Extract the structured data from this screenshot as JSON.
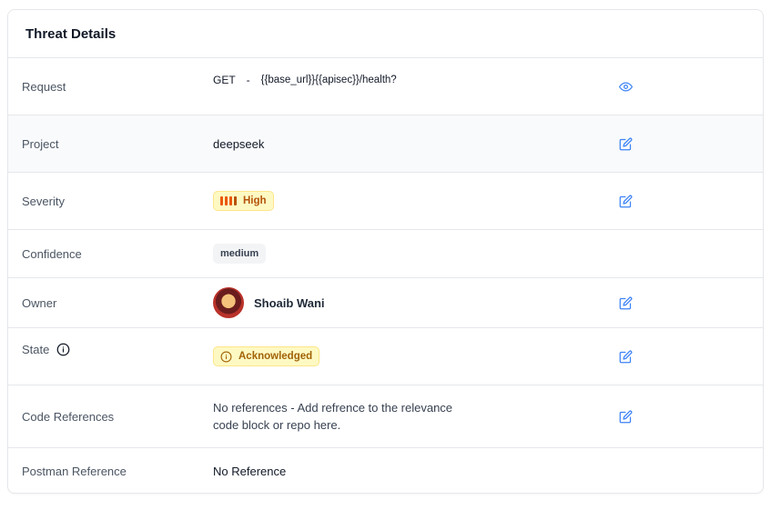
{
  "card": {
    "title": "Threat Details"
  },
  "rows": {
    "request": {
      "label": "Request",
      "method": "GET",
      "separator": "-",
      "url": "{{base_url}}{{apisec}}/health?",
      "action_icon": "eye-icon"
    },
    "project": {
      "label": "Project",
      "value": "deepseek",
      "action_icon": "edit-icon"
    },
    "severity": {
      "label": "Severity",
      "value": "High",
      "action_icon": "edit-icon",
      "bar_colors": [
        "#ea580c",
        "#ea580c",
        "#ea580c",
        "#b45309"
      ]
    },
    "confidence": {
      "label": "Confidence",
      "value": "medium"
    },
    "owner": {
      "label": "Owner",
      "value": "Shoaib Wani",
      "action_icon": "edit-icon"
    },
    "state": {
      "label": "State",
      "value": "Acknowledged",
      "action_icon": "edit-icon",
      "info_icon": "info-icon"
    },
    "code_references": {
      "label": "Code References",
      "value": "No references - Add refrence to the relevance code block or repo here.",
      "action_icon": "edit-icon"
    },
    "postman_reference": {
      "label": "Postman Reference",
      "value": "No Reference"
    }
  },
  "colors": {
    "accent": "#3b82f6",
    "warning_bg": "#fef9c3",
    "warning_text": "#a16207"
  }
}
